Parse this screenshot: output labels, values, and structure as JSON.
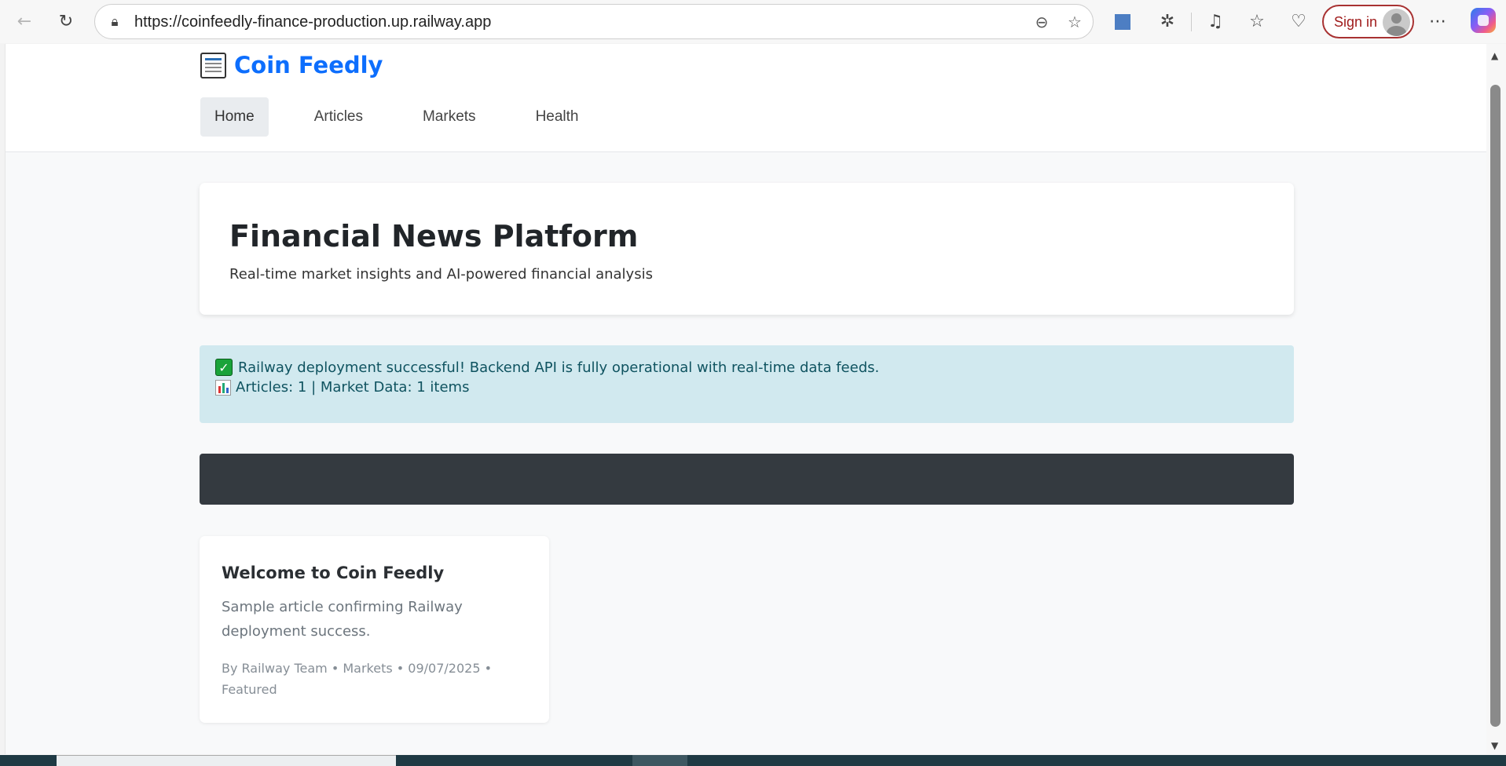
{
  "browser": {
    "url": "https://coinfeedly-finance-production.up.railway.app",
    "signin_label": "Sign in"
  },
  "site": {
    "brand": "Coin Feedly",
    "nav": [
      {
        "label": "Home",
        "active": true
      },
      {
        "label": "Articles",
        "active": false
      },
      {
        "label": "Markets",
        "active": false
      },
      {
        "label": "Health",
        "active": false
      }
    ]
  },
  "hero": {
    "title": "Financial News Platform",
    "subtitle": "Real-time market insights and AI-powered financial analysis"
  },
  "alert": {
    "line1": "Railway deployment successful! Backend API is fully operational with real-time data feeds.",
    "line2": "Articles: 1 | Market Data: 1 items"
  },
  "articles": [
    {
      "title": "Welcome to Coin Feedly",
      "excerpt": "Sample article confirming Railway deployment success.",
      "meta": "By Railway Team • Markets • 09/07/2025 • Featured"
    }
  ],
  "colors": {
    "brand": "#0d6efd",
    "alert_bg": "#d1e9ef",
    "dark_bar": "#343a40",
    "signin_border": "#a83232"
  },
  "icons": [
    "back-icon",
    "refresh-icon",
    "lock-icon",
    "zoom-out-icon",
    "favorite-star-icon",
    "extension-icon",
    "puzzle-icon",
    "media-icon",
    "favorites-icon",
    "health-icon",
    "more-icon",
    "copilot-icon",
    "newspaper-icon",
    "check-icon",
    "bar-chart-icon"
  ]
}
